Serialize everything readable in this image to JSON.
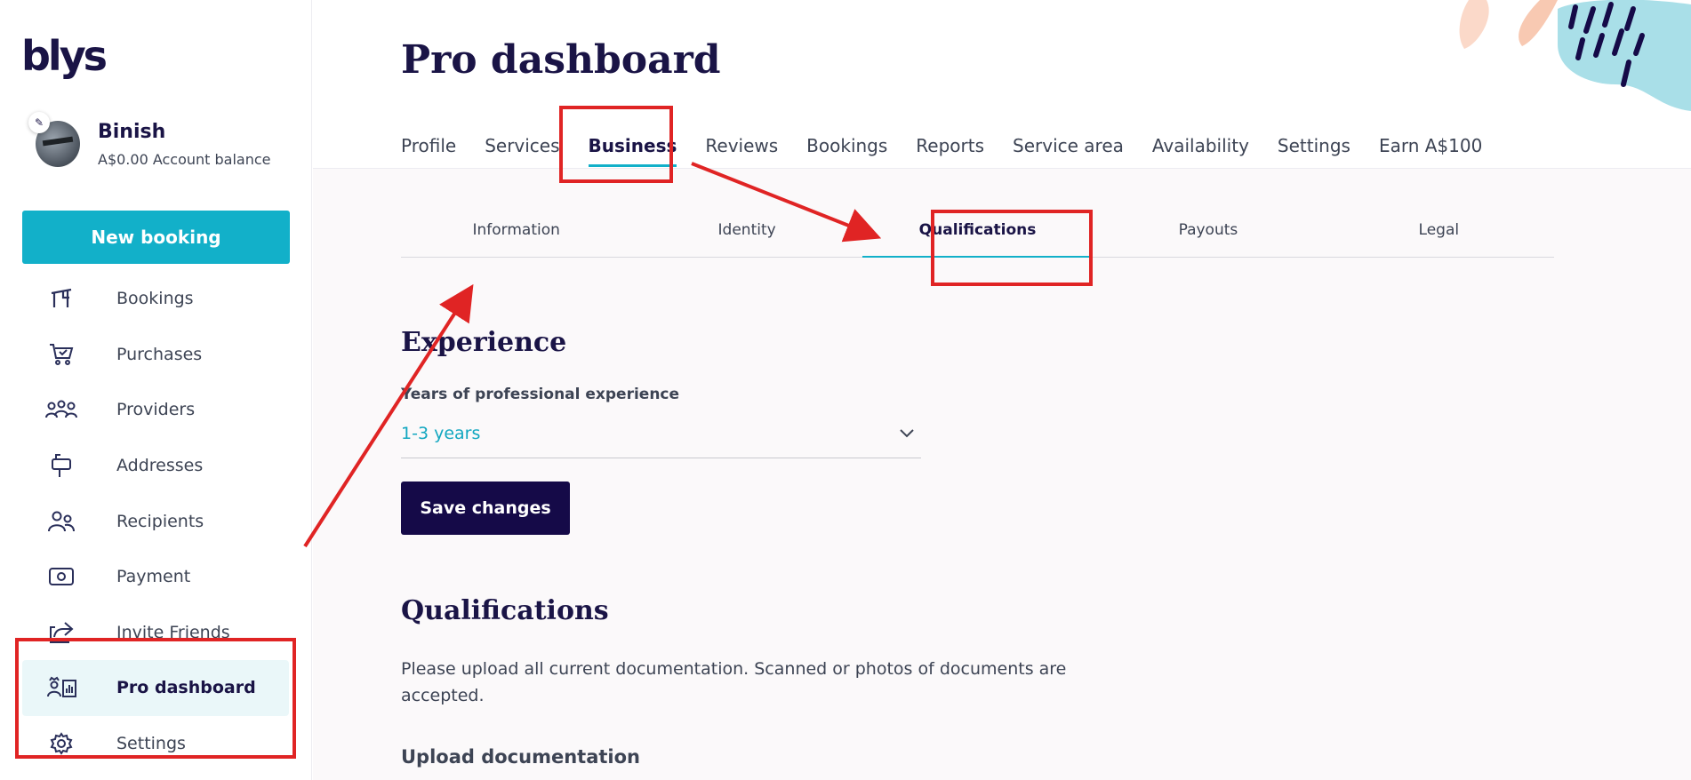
{
  "logo": {
    "text": "blys"
  },
  "profile": {
    "name": "Binish",
    "balance": "A$0.00 Account balance"
  },
  "sidebar": {
    "new_booking_label": "New booking",
    "items": [
      {
        "label": "Bookings",
        "icon": "bookings-icon"
      },
      {
        "label": "Purchases",
        "icon": "cart-icon"
      },
      {
        "label": "Providers",
        "icon": "providers-icon"
      },
      {
        "label": "Addresses",
        "icon": "mailbox-icon"
      },
      {
        "label": "Recipients",
        "icon": "recipients-icon"
      },
      {
        "label": "Payment",
        "icon": "payment-icon"
      },
      {
        "label": "Invite Friends",
        "icon": "share-icon"
      },
      {
        "label": "Pro dashboard",
        "icon": "pro-dashboard-icon",
        "active": true
      },
      {
        "label": "Settings",
        "icon": "gear-icon"
      }
    ]
  },
  "header": {
    "title": "Pro dashboard",
    "tabs": [
      {
        "label": "Profile"
      },
      {
        "label": "Services"
      },
      {
        "label": "Business",
        "active": true
      },
      {
        "label": "Reviews"
      },
      {
        "label": "Bookings"
      },
      {
        "label": "Reports"
      },
      {
        "label": "Service area"
      },
      {
        "label": "Availability"
      },
      {
        "label": "Settings"
      },
      {
        "label": "Earn A$100"
      }
    ]
  },
  "subtabs": [
    {
      "label": "Information"
    },
    {
      "label": "Identity"
    },
    {
      "label": "Qualifications",
      "active": true
    },
    {
      "label": "Payouts"
    },
    {
      "label": "Legal"
    }
  ],
  "experience": {
    "title": "Experience",
    "field_label": "Years of professional experience",
    "selected_value": "1-3 years",
    "save_label": "Save changes"
  },
  "qualifications": {
    "title": "Qualifications",
    "description": "Please upload all current documentation. Scanned or photos of documents are accepted.",
    "upload_title": "Upload documentation"
  },
  "colors": {
    "accent": "#12b0c9",
    "primary_dark": "#150a48",
    "annotation": "#e02424"
  }
}
